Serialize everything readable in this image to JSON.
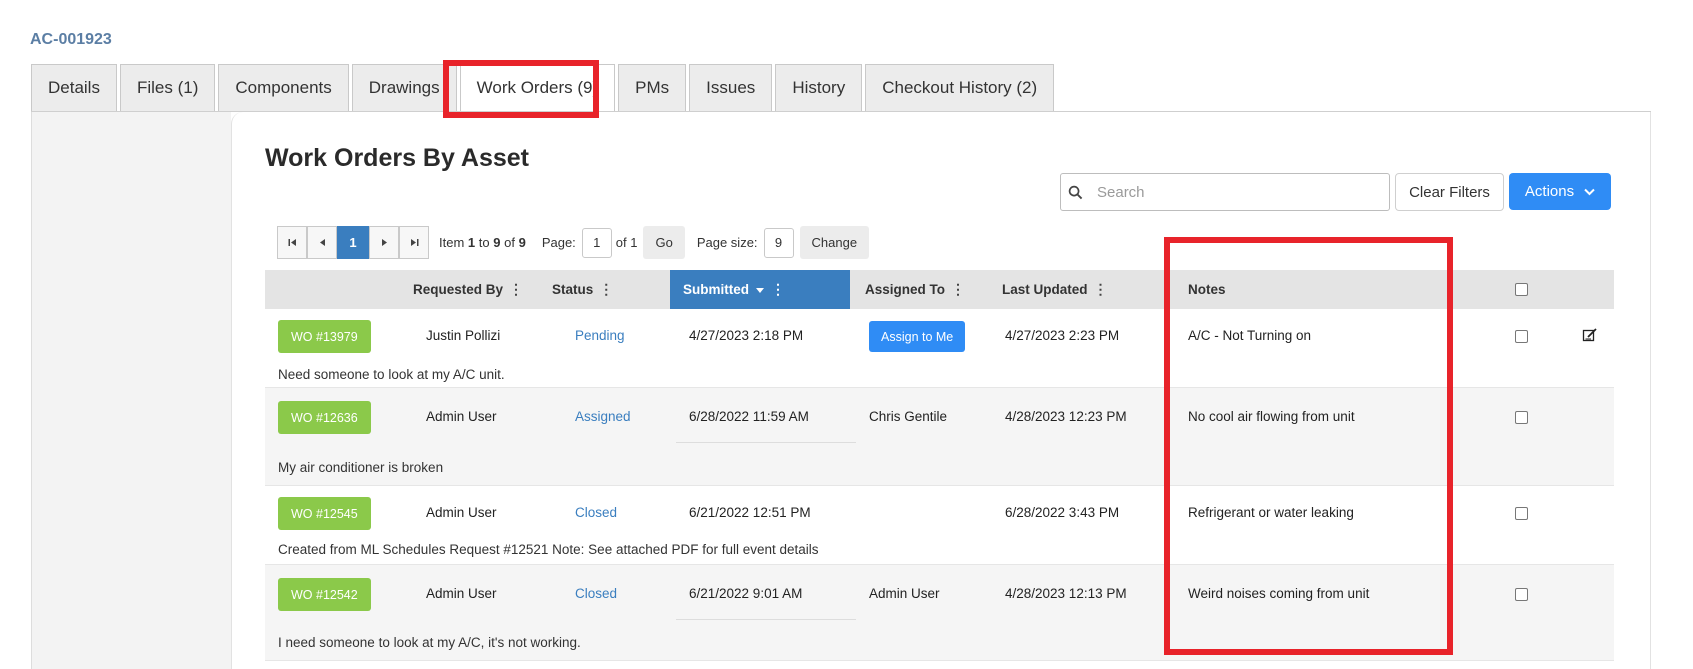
{
  "asset": {
    "id": "AC-001923"
  },
  "tabs": [
    {
      "label": "Details"
    },
    {
      "label": "Files (1)"
    },
    {
      "label": "Components"
    },
    {
      "label": "Drawings"
    },
    {
      "label": "Work Orders (9)"
    },
    {
      "label": "PMs"
    },
    {
      "label": "Issues"
    },
    {
      "label": "History"
    },
    {
      "label": "Checkout History (2)"
    }
  ],
  "active_tab": "Work Orders (9)",
  "page": {
    "title": "Work Orders By Asset"
  },
  "search": {
    "placeholder": "Search",
    "icon": "search-icon"
  },
  "toolbar": {
    "clear_label": "Clear Filters",
    "actions_label": "Actions"
  },
  "pager": {
    "current_page": "1",
    "item_prefix": "Item",
    "item_from": "1",
    "item_to_word": "to",
    "item_to": "9",
    "item_of_word": "of",
    "item_total": "9",
    "page_label": "Page:",
    "page_value": "1",
    "of_pages": "of 1",
    "go_label": "Go",
    "size_label": "Page size:",
    "size_value": "9",
    "change_label": "Change"
  },
  "columns": {
    "requested_by": "Requested By",
    "status": "Status",
    "submitted": "Submitted",
    "assigned_to": "Assigned To",
    "last_updated": "Last Updated",
    "notes": "Notes"
  },
  "rows": [
    {
      "wo": "WO #13979",
      "requested_by": "Justin Pollizi",
      "status": "Pending",
      "submitted": "4/27/2023 2:18 PM",
      "assigned_to": "",
      "assign_label": "Assign to Me",
      "last_updated": "4/27/2023 2:23 PM",
      "notes": "A/C - Not Turning on",
      "description": "Need someone to look at my A/C unit."
    },
    {
      "wo": "WO #12636",
      "requested_by": "Admin User",
      "status": "Assigned",
      "submitted": "6/28/2022 11:59 AM",
      "assigned_to": "Chris Gentile",
      "last_updated": "4/28/2023 12:23 PM",
      "notes": "No cool air flowing from unit",
      "description": "My air conditioner is broken"
    },
    {
      "wo": "WO #12545",
      "requested_by": "Admin User",
      "status": "Closed",
      "submitted": "6/21/2022 12:51 PM",
      "assigned_to": "",
      "last_updated": "6/28/2022 3:43 PM",
      "notes": "Refrigerant or water leaking",
      "description": "Created from ML Schedules Request #12521 Note: See attached PDF for full event details"
    },
    {
      "wo": "WO #12542",
      "requested_by": "Admin User",
      "status": "Closed",
      "submitted": "6/21/2022 9:01 AM",
      "assigned_to": "Admin User",
      "last_updated": "4/28/2023 12:13 PM",
      "notes": "Weird noises coming from unit",
      "description": "I need someone to look at my A/C, it's not working."
    }
  ],
  "colors": {
    "accent": "#3a7ebf",
    "wo_button": "#8bc94a",
    "primary_button": "#2f8cf5",
    "highlight": "#e8232a"
  }
}
